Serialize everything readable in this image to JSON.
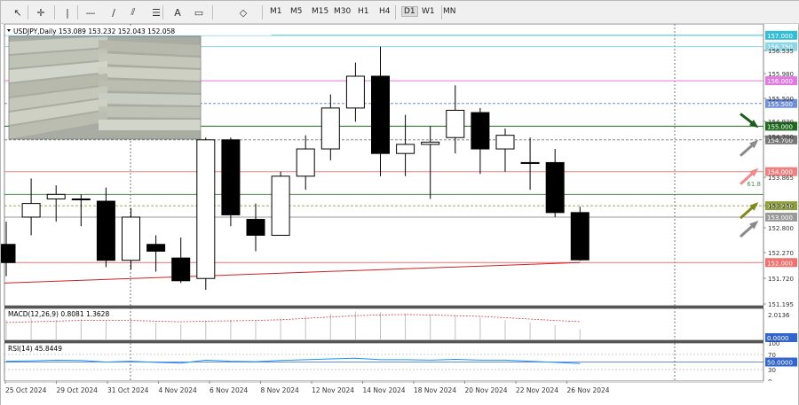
{
  "toolbar": {
    "timeframes": [
      "M1",
      "M5",
      "M15",
      "M30",
      "H1",
      "H4",
      "D1",
      "W1",
      "MN"
    ],
    "active_timeframe": "D1",
    "tools": [
      {
        "name": "cursor-arrow-icon",
        "glyph": "↖"
      },
      {
        "name": "crosshair-icon",
        "glyph": "✛"
      },
      {
        "name": "vertical-line-icon",
        "glyph": "|"
      },
      {
        "name": "horizontal-line-icon",
        "glyph": "—"
      },
      {
        "name": "trendline-icon",
        "glyph": "∕"
      },
      {
        "name": "channel-icon",
        "glyph": "⫽"
      },
      {
        "name": "fibonacci-icon",
        "glyph": "☰"
      },
      {
        "name": "text-icon",
        "glyph": "A"
      },
      {
        "name": "label-icon",
        "glyph": "▭"
      },
      {
        "name": "shapes-icon",
        "glyph": "◇"
      }
    ]
  },
  "chart_data": {
    "type": "candlestick",
    "symbol_label": "USDJPY,Daily",
    "ohlc_label": "153.089 153.232 152.043 152.058",
    "price_axis_ticks": [
      "156.535",
      "155.980",
      "155.500",
      "154.930",
      "154.700",
      "153.865",
      "153.250",
      "152.800",
      "152.270",
      "151.720",
      "151.195"
    ],
    "date_labels": [
      "25 Oct 2024",
      "29 Oct 2024",
      "31 Oct 2024",
      "4 Nov 2024",
      "6 Nov 2024",
      "8 Nov 2024",
      "12 Nov 2024",
      "14 Nov 2024",
      "18 Nov 2024",
      "20 Nov 2024",
      "22 Nov 2024",
      "26 Nov 2024"
    ],
    "candles": [
      {
        "o": 152.4,
        "h": 152.9,
        "l": 151.7,
        "c": 152.0
      },
      {
        "o": 153.0,
        "h": 153.85,
        "l": 152.6,
        "c": 153.3
      },
      {
        "o": 153.4,
        "h": 153.7,
        "l": 152.9,
        "c": 153.5
      },
      {
        "o": 153.4,
        "h": 153.5,
        "l": 152.8,
        "c": 153.4
      },
      {
        "o": 153.35,
        "h": 153.65,
        "l": 151.9,
        "c": 152.05
      },
      {
        "o": 152.05,
        "h": 153.2,
        "l": 151.85,
        "c": 153.0
      },
      {
        "o": 152.4,
        "h": 152.6,
        "l": 151.8,
        "c": 152.25
      },
      {
        "o": 152.1,
        "h": 152.55,
        "l": 151.55,
        "c": 151.6
      },
      {
        "o": 151.65,
        "h": 154.75,
        "l": 151.4,
        "c": 154.7
      },
      {
        "o": 154.7,
        "h": 154.75,
        "l": 152.8,
        "c": 153.05
      },
      {
        "o": 152.95,
        "h": 153.3,
        "l": 152.25,
        "c": 152.6
      },
      {
        "o": 152.6,
        "h": 154.0,
        "l": 152.6,
        "c": 153.9
      },
      {
        "o": 153.9,
        "h": 154.8,
        "l": 153.6,
        "c": 154.5
      },
      {
        "o": 154.5,
        "h": 155.7,
        "l": 154.25,
        "c": 155.4
      },
      {
        "o": 155.4,
        "h": 156.4,
        "l": 155.1,
        "c": 156.1
      },
      {
        "o": 156.1,
        "h": 156.75,
        "l": 153.9,
        "c": 154.4
      },
      {
        "o": 154.4,
        "h": 155.25,
        "l": 153.9,
        "c": 154.6
      },
      {
        "o": 154.6,
        "h": 155.0,
        "l": 153.4,
        "c": 154.65
      },
      {
        "o": 154.75,
        "h": 155.9,
        "l": 154.4,
        "c": 155.35
      },
      {
        "o": 155.3,
        "h": 155.4,
        "l": 153.95,
        "c": 154.5
      },
      {
        "o": 154.5,
        "h": 154.95,
        "l": 154.0,
        "c": 154.8
      },
      {
        "o": 154.2,
        "h": 154.75,
        "l": 153.6,
        "c": 154.2
      },
      {
        "o": 154.2,
        "h": 154.5,
        "l": 153.0,
        "c": 153.1
      },
      {
        "o": 153.1,
        "h": 153.23,
        "l": 152.04,
        "c": 152.06
      }
    ],
    "horizontal_levels": [
      {
        "price": 157.0,
        "label": "157.000",
        "color": "#33bdd6",
        "style": "solid"
      },
      {
        "price": 156.75,
        "label": "156.750",
        "color": "#8cd6e6",
        "style": "solid"
      },
      {
        "price": 156.0,
        "label": "156.000",
        "color": "#e07ae0",
        "style": "solid"
      },
      {
        "price": 155.5,
        "label": "155.500",
        "color": "#6f8fd6",
        "style": "dashed"
      },
      {
        "price": 155.0,
        "label": "155.000",
        "color": "#1d6b1d",
        "style": "solid"
      },
      {
        "price": 154.7,
        "label": "154.700",
        "color": "#777777",
        "style": "dashed"
      },
      {
        "price": 154.0,
        "label": "154.000",
        "color": "#f08080",
        "style": "solid"
      },
      {
        "price": 153.5,
        "label": "",
        "color": "#4f8f4f",
        "style": "solid"
      },
      {
        "price": 153.25,
        "label": "153.250",
        "color": "#8f9f3a",
        "style": "dashed"
      },
      {
        "price": 153.0,
        "label": "153.000",
        "color": "#9a9a9a",
        "style": "solid"
      },
      {
        "price": 152.0,
        "label": "152.000",
        "color": "#f07070",
        "style": "solid"
      }
    ],
    "fib_label": "61.8",
    "trendline": {
      "start": {
        "i": 0,
        "price": 151.55
      },
      "end": {
        "i": 23,
        "price": 152.0
      },
      "color": "#cc2222"
    },
    "arrows": [
      {
        "name": "dark-green-arrow-icon",
        "color": "#1d5c1d",
        "direction": "down-right",
        "price": 155.0
      },
      {
        "name": "gray-arrow-icon",
        "color": "#8a8a8a",
        "direction": "up-right",
        "price": 154.7
      },
      {
        "name": "pink-arrow-icon",
        "color": "#f28a8a",
        "direction": "up-right",
        "price": 154.0
      },
      {
        "name": "olive-arrow-icon",
        "color": "#808a1a",
        "direction": "up-right",
        "price": 153.25
      },
      {
        "name": "gray-arrow-icon",
        "color": "#8a8a8a",
        "direction": "up-right",
        "price": 153.0
      }
    ],
    "macd": {
      "label": "MACD(12,26,9) 0.8081 1.3628",
      "ticks": [
        "2.0136",
        "0.0000"
      ],
      "histogram": [
        1.5,
        1.6,
        1.5,
        1.55,
        1.4,
        1.45,
        1.3,
        1.2,
        1.45,
        1.5,
        1.45,
        1.6,
        1.8,
        1.95,
        2.1,
        2.05,
        1.95,
        1.9,
        1.85,
        1.7,
        1.5,
        1.3,
        1.1,
        0.81
      ],
      "signal": [
        1.3,
        1.35,
        1.4,
        1.45,
        1.45,
        1.45,
        1.4,
        1.35,
        1.4,
        1.42,
        1.45,
        1.5,
        1.6,
        1.7,
        1.8,
        1.85,
        1.88,
        1.85,
        1.8,
        1.75,
        1.65,
        1.55,
        1.45,
        1.36
      ]
    },
    "rsi": {
      "label": "RSI(14) 45.8449",
      "ticks": [
        "100",
        "70",
        "50",
        "30",
        "0"
      ],
      "highlight": "50.0000",
      "values": [
        52,
        53,
        55,
        54,
        50,
        52,
        49,
        47,
        55,
        52,
        51,
        54,
        56,
        58,
        60,
        56,
        56,
        55,
        57,
        55,
        55,
        52,
        49,
        45.8
      ]
    }
  }
}
